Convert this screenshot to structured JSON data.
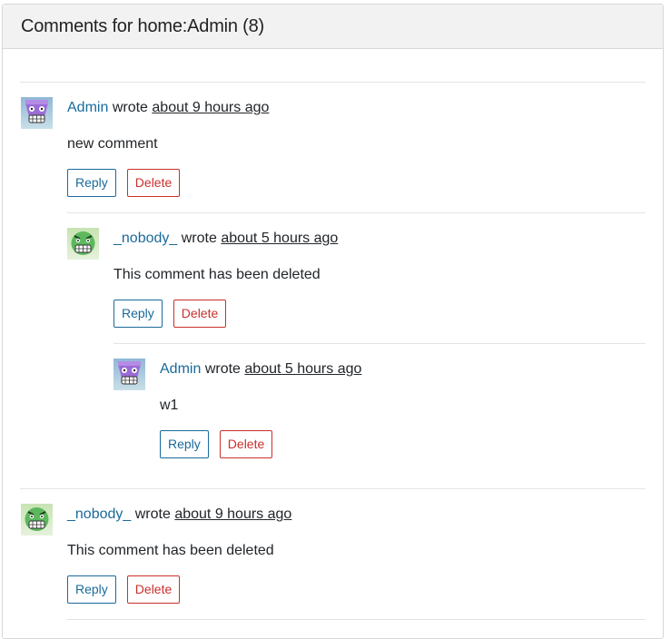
{
  "header": {
    "title": "Comments for home:Admin (8)"
  },
  "comments": [
    {
      "author": "Admin",
      "wrote": "wrote",
      "time": "about 9 hours ago",
      "text": "new comment",
      "reply_label": "Reply",
      "delete_label": "Delete",
      "avatar": "purple-grin-avatar"
    },
    {
      "author": "_nobody_",
      "wrote": "wrote",
      "time": "about 5 hours ago",
      "text": "This comment has been deleted",
      "reply_label": "Reply",
      "delete_label": "Delete",
      "avatar": "green-grimace-avatar"
    },
    {
      "author": "Admin",
      "wrote": "wrote",
      "time": "about 5 hours ago",
      "text": "w1",
      "reply_label": "Reply",
      "delete_label": "Delete",
      "avatar": "purple-grin-avatar"
    },
    {
      "author": "_nobody_",
      "wrote": "wrote",
      "time": "about 9 hours ago",
      "text": "This comment has been deleted",
      "reply_label": "Reply",
      "delete_label": "Delete",
      "avatar": "green-grimace-avatar"
    }
  ],
  "colors": {
    "link": "#1a6a9a",
    "delete": "#c9302c",
    "header_bg": "#f2f2f2"
  }
}
